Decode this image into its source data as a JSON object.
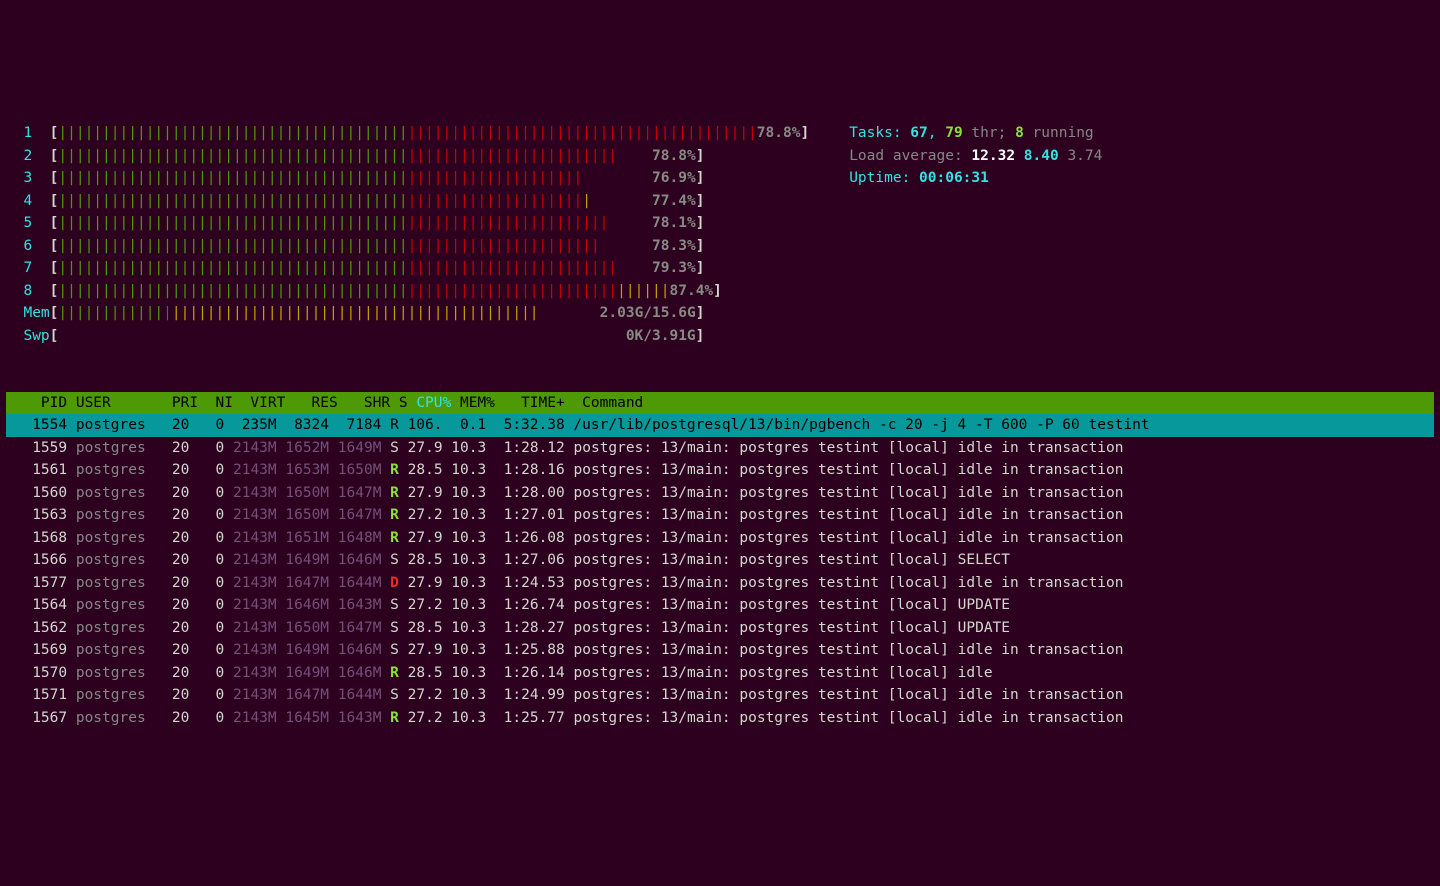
{
  "cpus": [
    {
      "n": "1",
      "pct": "78.8%",
      "green": 40,
      "red": 40,
      "yellow": 0
    },
    {
      "n": "2",
      "pct": "78.8%",
      "green": 40,
      "red": 24,
      "yellow": 0
    },
    {
      "n": "3",
      "pct": "76.9%",
      "green": 40,
      "red": 20,
      "yellow": 0
    },
    {
      "n": "4",
      "pct": "77.4%",
      "green": 40,
      "red": 20,
      "yellow": 1
    },
    {
      "n": "5",
      "pct": "78.1%",
      "green": 40,
      "red": 23,
      "yellow": 0
    },
    {
      "n": "6",
      "pct": "78.3%",
      "green": 40,
      "red": 22,
      "yellow": 0
    },
    {
      "n": "7",
      "pct": "79.3%",
      "green": 40,
      "red": 24,
      "yellow": 0
    },
    {
      "n": "8",
      "pct": "87.4%",
      "green": 40,
      "red": 24,
      "yellow": 6
    }
  ],
  "mem": {
    "label": "Mem",
    "green": 12,
    "blue": 1,
    "yellow": 42,
    "text": "2.03G/15.6G"
  },
  "swp": {
    "label": "Swp",
    "text": "0K/3.91G"
  },
  "info": {
    "tasks_lbl": "Tasks: ",
    "tasks_n": "67",
    "tasks_sep": ", ",
    "thr_n": "79",
    "thr_lbl": " thr; ",
    "running_n": "8",
    "running_lbl": " running",
    "load_lbl": "Load average: ",
    "load1": "12.32",
    "load5": "8.40",
    "load15": "3.74",
    "uptime_lbl": "Uptime: ",
    "uptime": "00:06:31"
  },
  "header": {
    "cols": "    PID USER       PRI  NI  VIRT   RES   SHR S ",
    "sortcol": "CPU%▽",
    "cols2": "MEM%   TIME+  Command"
  },
  "selected": {
    "pid": "1554",
    "user": "postgres",
    "pri": "20",
    "ni": "0",
    "virt": "235M",
    "res": "8324",
    "shr": "7184",
    "s": "R",
    "cpu": "106.",
    "mem": "0.1",
    "time": "5:32.38",
    "cmd": "/usr/lib/postgresql/13/bin/pgbench -c 20 -j 4 -T 600 -P 60 testint"
  },
  "procs": [
    {
      "pid": "1559",
      "user": "postgres",
      "pri": "20",
      "ni": "0",
      "virt": "2143M",
      "res": "1652M",
      "shr": "1649M",
      "s": "S",
      "cpu": "27.9",
      "mem": "10.3",
      "time": "1:28.12",
      "cmd": "postgres: 13/main: postgres testint [local] idle in transaction"
    },
    {
      "pid": "1561",
      "user": "postgres",
      "pri": "20",
      "ni": "0",
      "virt": "2143M",
      "res": "1653M",
      "shr": "1650M",
      "s": "R",
      "cpu": "28.5",
      "mem": "10.3",
      "time": "1:28.16",
      "cmd": "postgres: 13/main: postgres testint [local] idle in transaction"
    },
    {
      "pid": "1560",
      "user": "postgres",
      "pri": "20",
      "ni": "0",
      "virt": "2143M",
      "res": "1650M",
      "shr": "1647M",
      "s": "R",
      "cpu": "27.9",
      "mem": "10.3",
      "time": "1:28.00",
      "cmd": "postgres: 13/main: postgres testint [local] idle in transaction"
    },
    {
      "pid": "1563",
      "user": "postgres",
      "pri": "20",
      "ni": "0",
      "virt": "2143M",
      "res": "1650M",
      "shr": "1647M",
      "s": "R",
      "cpu": "27.2",
      "mem": "10.3",
      "time": "1:27.01",
      "cmd": "postgres: 13/main: postgres testint [local] idle in transaction"
    },
    {
      "pid": "1568",
      "user": "postgres",
      "pri": "20",
      "ni": "0",
      "virt": "2143M",
      "res": "1651M",
      "shr": "1648M",
      "s": "R",
      "cpu": "27.9",
      "mem": "10.3",
      "time": "1:26.08",
      "cmd": "postgres: 13/main: postgres testint [local] idle in transaction"
    },
    {
      "pid": "1566",
      "user": "postgres",
      "pri": "20",
      "ni": "0",
      "virt": "2143M",
      "res": "1649M",
      "shr": "1646M",
      "s": "S",
      "cpu": "28.5",
      "mem": "10.3",
      "time": "1:27.06",
      "cmd": "postgres: 13/main: postgres testint [local] SELECT"
    },
    {
      "pid": "1577",
      "user": "postgres",
      "pri": "20",
      "ni": "0",
      "virt": "2143M",
      "res": "1647M",
      "shr": "1644M",
      "s": "D",
      "cpu": "27.9",
      "mem": "10.3",
      "time": "1:24.53",
      "cmd": "postgres: 13/main: postgres testint [local] idle in transaction"
    },
    {
      "pid": "1564",
      "user": "postgres",
      "pri": "20",
      "ni": "0",
      "virt": "2143M",
      "res": "1646M",
      "shr": "1643M",
      "s": "S",
      "cpu": "27.2",
      "mem": "10.3",
      "time": "1:26.74",
      "cmd": "postgres: 13/main: postgres testint [local] UPDATE"
    },
    {
      "pid": "1562",
      "user": "postgres",
      "pri": "20",
      "ni": "0",
      "virt": "2143M",
      "res": "1650M",
      "shr": "1647M",
      "s": "S",
      "cpu": "28.5",
      "mem": "10.3",
      "time": "1:28.27",
      "cmd": "postgres: 13/main: postgres testint [local] UPDATE"
    },
    {
      "pid": "1569",
      "user": "postgres",
      "pri": "20",
      "ni": "0",
      "virt": "2143M",
      "res": "1649M",
      "shr": "1646M",
      "s": "S",
      "cpu": "27.9",
      "mem": "10.3",
      "time": "1:25.88",
      "cmd": "postgres: 13/main: postgres testint [local] idle in transaction"
    },
    {
      "pid": "1570",
      "user": "postgres",
      "pri": "20",
      "ni": "0",
      "virt": "2143M",
      "res": "1649M",
      "shr": "1646M",
      "s": "R",
      "cpu": "28.5",
      "mem": "10.3",
      "time": "1:26.14",
      "cmd": "postgres: 13/main: postgres testint [local] idle"
    },
    {
      "pid": "1571",
      "user": "postgres",
      "pri": "20",
      "ni": "0",
      "virt": "2143M",
      "res": "1647M",
      "shr": "1644M",
      "s": "S",
      "cpu": "27.2",
      "mem": "10.3",
      "time": "1:24.99",
      "cmd": "postgres: 13/main: postgres testint [local] idle in transaction"
    },
    {
      "pid": "1567",
      "user": "postgres",
      "pri": "20",
      "ni": "0",
      "virt": "2143M",
      "res": "1645M",
      "shr": "1643M",
      "s": "R",
      "cpu": "27.2",
      "mem": "10.3",
      "time": "1:25.77",
      "cmd": "postgres: 13/main: postgres testint [local] idle in transaction"
    }
  ]
}
